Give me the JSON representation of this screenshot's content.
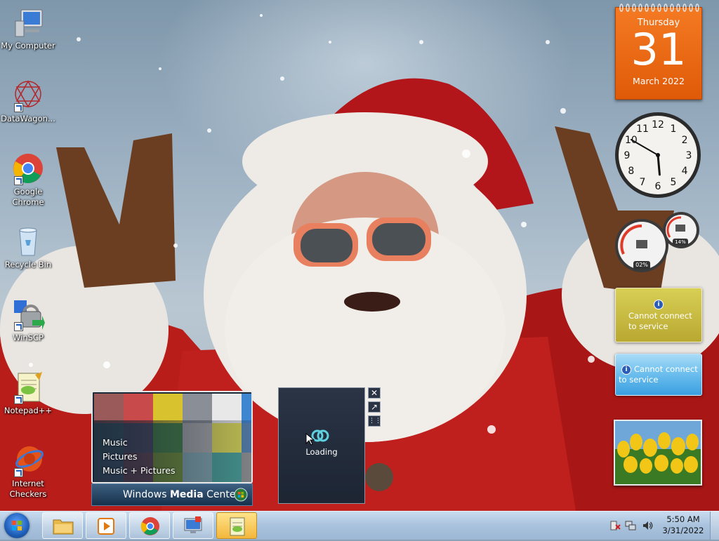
{
  "desktop": {
    "icons": [
      {
        "label": "My Computer",
        "icon": "computer-icon",
        "shortcut": false
      },
      {
        "label": "DataWagon...",
        "icon": "datawagon-icon",
        "shortcut": true
      },
      {
        "label": "Google Chrome",
        "icon": "chrome-icon",
        "shortcut": true
      },
      {
        "label": "Recycle Bin",
        "icon": "recycle-bin-icon",
        "shortcut": false
      },
      {
        "label": "WinSCP",
        "icon": "winscp-icon",
        "shortcut": true
      },
      {
        "label": "Notepad++",
        "icon": "notepadpp-icon",
        "shortcut": true
      },
      {
        "label": "Internet Checkers",
        "icon": "checkers-icon",
        "shortcut": true
      }
    ]
  },
  "gadgets": {
    "calendar": {
      "weekday": "Thursday",
      "day": "31",
      "month_year": "March 2022",
      "color": "#f06a14"
    },
    "clock": {
      "hour": 5,
      "minute": 50
    },
    "meters": {
      "cpu": "02%",
      "memory": "14%"
    },
    "currency": {
      "message": "Cannot connect to service",
      "line1": "Cannot connect",
      "line2": "to service"
    },
    "feed": {
      "message": "Cannot connect to service",
      "line1": "Cannot connect",
      "line2": "to service"
    },
    "media_center": {
      "menu": [
        "Music",
        "Pictures",
        "Music + Pictures"
      ],
      "brand_regular": "Windows ",
      "brand_bold": "Media",
      "brand_tail": " Center"
    },
    "loading": {
      "label": "Loading"
    }
  },
  "taskbar": {
    "buttons": [
      {
        "name": "explorer",
        "icon": "folder-icon"
      },
      {
        "name": "media-player",
        "icon": "media-player-icon"
      },
      {
        "name": "chrome",
        "icon": "chrome-icon"
      },
      {
        "name": "remote-desktop",
        "icon": "monitor-icon"
      },
      {
        "name": "notepadpp",
        "icon": "notepadpp-icon",
        "active": true
      }
    ],
    "tray": {
      "icons": [
        "action-center-icon",
        "network-icon",
        "volume-icon"
      ]
    },
    "time": "5:50 AM",
    "date": "3/31/2022"
  }
}
